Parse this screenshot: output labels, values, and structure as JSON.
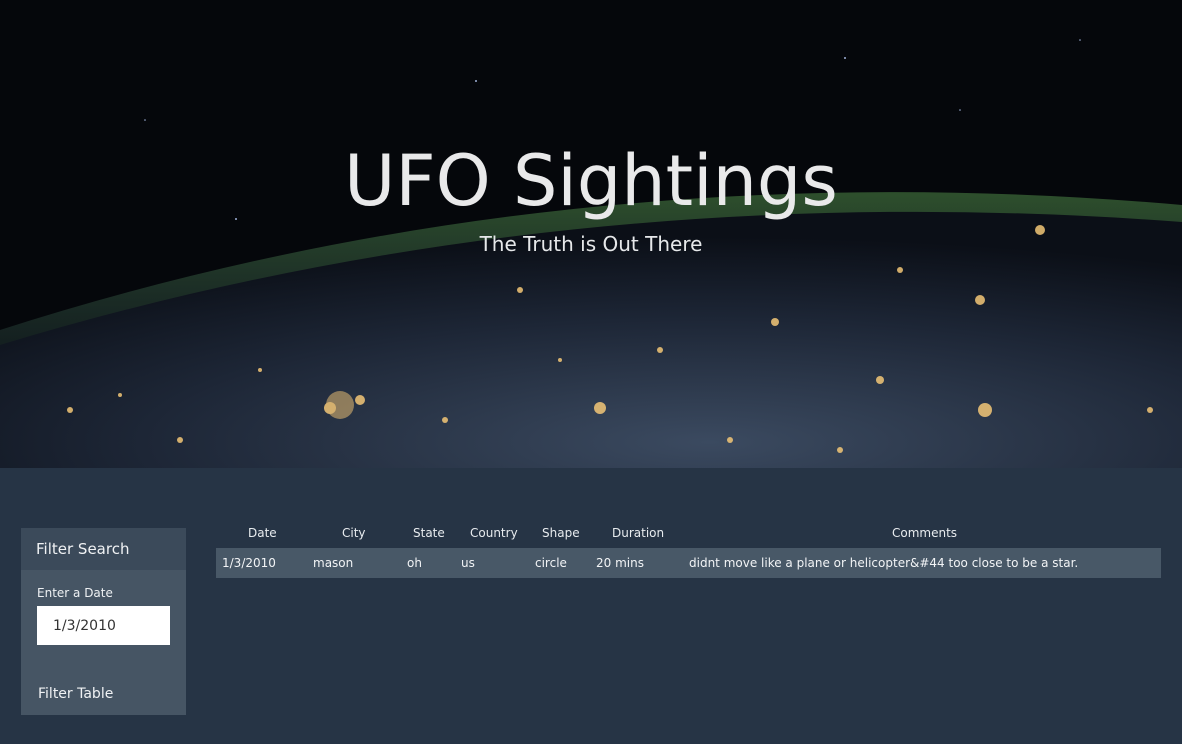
{
  "hero": {
    "title": "UFO Sightings",
    "subtitle": "The Truth is Out There"
  },
  "filter": {
    "header": "Filter Search",
    "date_label": "Enter a Date",
    "date_value": "1/3/2010",
    "button_label": "Filter Table"
  },
  "table": {
    "columns": [
      "Date",
      "City",
      "State",
      "Country",
      "Shape",
      "Duration",
      "Comments"
    ],
    "rows": [
      {
        "date": "1/3/2010",
        "city": "mason",
        "state": "oh",
        "country": "us",
        "shape": "circle",
        "duration": "20 mins",
        "comments": "didnt move like a plane or helicopter&#44 too close to be a star."
      }
    ]
  },
  "colors": {
    "page_background": "#263445",
    "panel_background": "#465564",
    "row_background": "#485867"
  }
}
